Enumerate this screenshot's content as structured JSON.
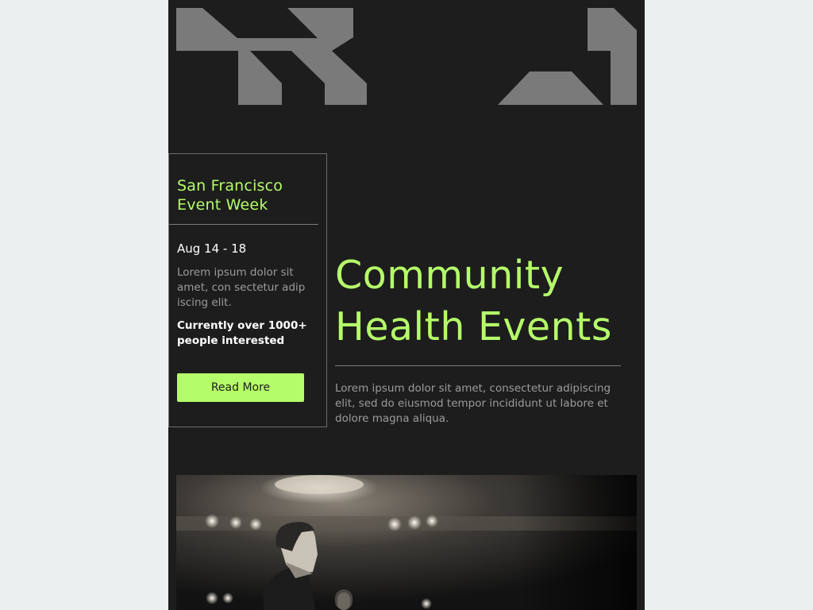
{
  "card": {
    "title": "San Francisco Event Week",
    "dates": "Aug 14 - 18",
    "description": "Lorem ipsum dolor sit amet, con sectetur adip iscing elit.",
    "interest": "Currently over 1000+ people interested",
    "button_label": "Read More"
  },
  "hero": {
    "title": "Community Health Events",
    "description": "Lorem ipsum dolor sit amet, consectetur adipiscing elit, sed do eiusmod tempor incididunt ut labore et dolore magna aliqua."
  },
  "colors": {
    "page_background": "#ebeff0",
    "email_background": "#1d1d1d",
    "accent": "#b5fc6a",
    "logo_gray": "#7a7a7a",
    "muted_text": "#9c9c9c",
    "divider": "#7c7c7c"
  },
  "icons": {
    "logo": "geometric-brand-logo",
    "photo": "speaker-at-microphone-photo"
  }
}
